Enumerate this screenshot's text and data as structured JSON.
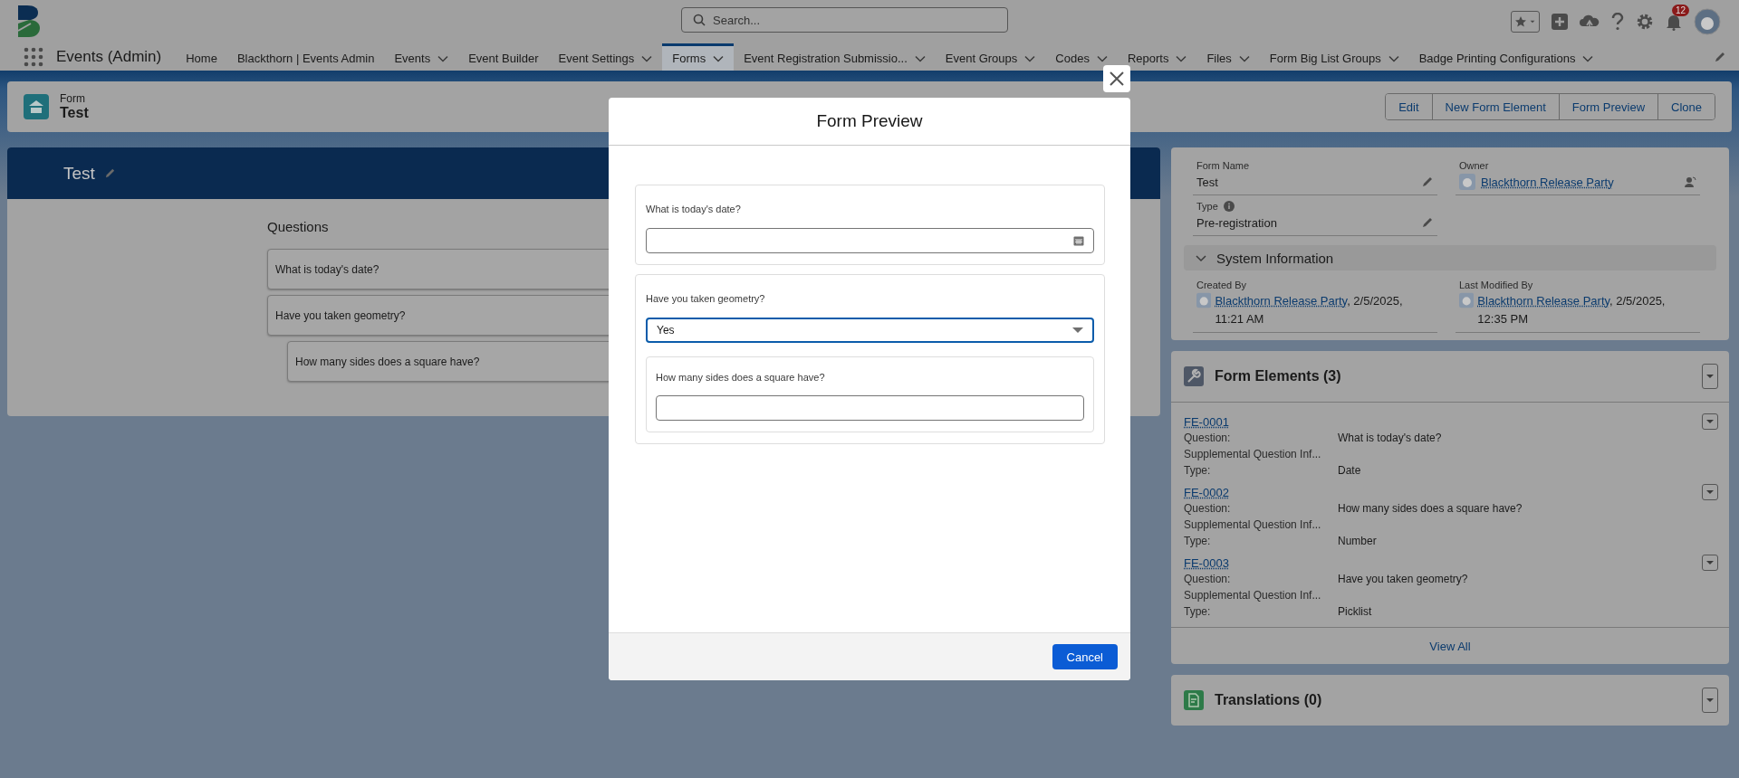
{
  "header": {
    "search_placeholder": "Search...",
    "notification_count": "12"
  },
  "nav": {
    "app_name": "Events (Admin)",
    "items": [
      {
        "label": "Home",
        "selected": false,
        "has_menu": false
      },
      {
        "label": "Blackthorn | Events Admin",
        "selected": false,
        "has_menu": false
      },
      {
        "label": "Events",
        "selected": false,
        "has_menu": true
      },
      {
        "label": "Event Builder",
        "selected": false,
        "has_menu": false
      },
      {
        "label": "Event Settings",
        "selected": false,
        "has_menu": true
      },
      {
        "label": "Forms",
        "selected": true,
        "has_menu": true
      },
      {
        "label": "Event Registration Submissio...",
        "selected": false,
        "has_menu": true
      },
      {
        "label": "Event Groups",
        "selected": false,
        "has_menu": true
      },
      {
        "label": "Codes",
        "selected": false,
        "has_menu": true
      },
      {
        "label": "Reports",
        "selected": false,
        "has_menu": true
      },
      {
        "label": "Files",
        "selected": false,
        "has_menu": true
      },
      {
        "label": "Form Big List Groups",
        "selected": false,
        "has_menu": true
      },
      {
        "label": "Badge Printing Configurations",
        "selected": false,
        "has_menu": true
      }
    ]
  },
  "highlights": {
    "object_type": "Form",
    "title": "Test",
    "actions": [
      "Edit",
      "New Form Element",
      "Form Preview",
      "Clone"
    ]
  },
  "builder": {
    "title": "Test",
    "heading": "Questions",
    "questions": [
      {
        "text": "What is today's date?"
      },
      {
        "text": "Have you taken geometry?",
        "children": [
          {
            "text": "How many sides does a square have?"
          }
        ]
      }
    ]
  },
  "details": {
    "fields": [
      {
        "label": "Form Name",
        "value": "Test",
        "kind": "text",
        "editable": true,
        "info": false
      },
      {
        "label": "Owner",
        "value": "Blackthorn Release Party",
        "kind": "user",
        "editable": false,
        "info": false
      },
      {
        "label": "Type",
        "value": "Pre-registration",
        "kind": "text",
        "editable": true,
        "info": true
      }
    ],
    "section": {
      "title": "System Information",
      "expanded": true,
      "fields": [
        {
          "label": "Created By",
          "user": "Blackthorn Release Party",
          "suffix": ", 2/5/2025, 11:21 AM"
        },
        {
          "label": "Last Modified By",
          "user": "Blackthorn Release Party",
          "suffix": ", 2/5/2025, 12:35 PM"
        }
      ]
    }
  },
  "related_lists": [
    {
      "kind": "elements",
      "title": "Form Elements (3)",
      "records": [
        {
          "name": "FE-0001",
          "fields": [
            {
              "label": "Question:",
              "value": "What is today's date?"
            },
            {
              "label": "Supplemental Question Inf..."
            },
            {
              "label": "Type:",
              "value": "Date"
            }
          ]
        },
        {
          "name": "FE-0002",
          "fields": [
            {
              "label": "Question:",
              "value": "How many sides does a square have?"
            },
            {
              "label": "Supplemental Question Inf..."
            },
            {
              "label": "Type:",
              "value": "Number"
            }
          ]
        },
        {
          "name": "FE-0003",
          "fields": [
            {
              "label": "Question:",
              "value": "Have you taken geometry?"
            },
            {
              "label": "Supplemental Question Inf..."
            },
            {
              "label": "Type:",
              "value": "Picklist"
            }
          ]
        }
      ],
      "footer": "View All"
    },
    {
      "kind": "translations",
      "title": "Translations (0)"
    }
  ],
  "modal": {
    "title": "Form Preview",
    "questions": [
      {
        "kind": "date",
        "label": "What is today's date?",
        "focused": false
      },
      {
        "kind": "picklist",
        "label": "Have you taken geometry?",
        "value": "Yes",
        "focused": true,
        "children": [
          {
            "kind": "number",
            "label": "How many sides does a square have?",
            "focused": false
          }
        ]
      }
    ],
    "cancel": "Cancel"
  }
}
